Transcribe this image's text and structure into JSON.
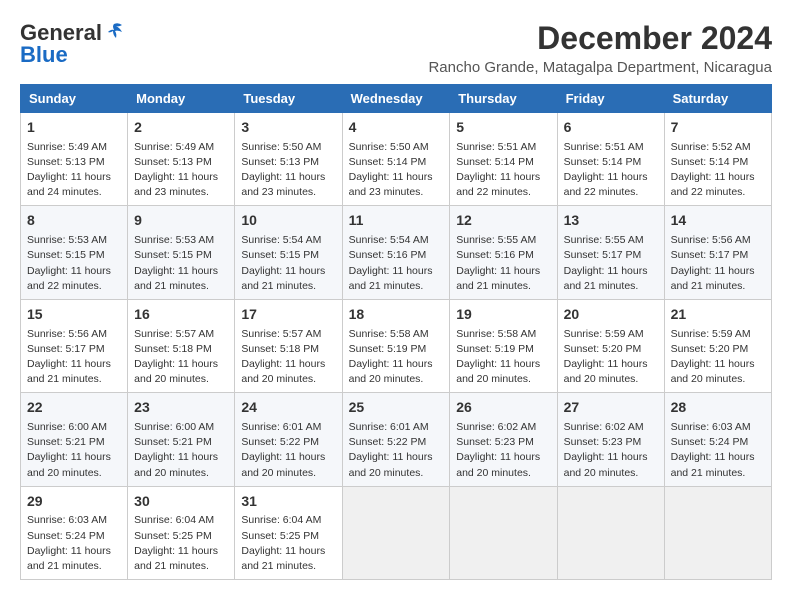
{
  "logo": {
    "general": "General",
    "blue": "Blue"
  },
  "title": "December 2024",
  "subtitle": "Rancho Grande, Matagalpa Department, Nicaragua",
  "columns": [
    "Sunday",
    "Monday",
    "Tuesday",
    "Wednesday",
    "Thursday",
    "Friday",
    "Saturday"
  ],
  "weeks": [
    [
      {
        "day": "1",
        "info": "Sunrise: 5:49 AM\nSunset: 5:13 PM\nDaylight: 11 hours\nand 24 minutes."
      },
      {
        "day": "2",
        "info": "Sunrise: 5:49 AM\nSunset: 5:13 PM\nDaylight: 11 hours\nand 23 minutes."
      },
      {
        "day": "3",
        "info": "Sunrise: 5:50 AM\nSunset: 5:13 PM\nDaylight: 11 hours\nand 23 minutes."
      },
      {
        "day": "4",
        "info": "Sunrise: 5:50 AM\nSunset: 5:14 PM\nDaylight: 11 hours\nand 23 minutes."
      },
      {
        "day": "5",
        "info": "Sunrise: 5:51 AM\nSunset: 5:14 PM\nDaylight: 11 hours\nand 22 minutes."
      },
      {
        "day": "6",
        "info": "Sunrise: 5:51 AM\nSunset: 5:14 PM\nDaylight: 11 hours\nand 22 minutes."
      },
      {
        "day": "7",
        "info": "Sunrise: 5:52 AM\nSunset: 5:14 PM\nDaylight: 11 hours\nand 22 minutes."
      }
    ],
    [
      {
        "day": "8",
        "info": "Sunrise: 5:53 AM\nSunset: 5:15 PM\nDaylight: 11 hours\nand 22 minutes."
      },
      {
        "day": "9",
        "info": "Sunrise: 5:53 AM\nSunset: 5:15 PM\nDaylight: 11 hours\nand 21 minutes."
      },
      {
        "day": "10",
        "info": "Sunrise: 5:54 AM\nSunset: 5:15 PM\nDaylight: 11 hours\nand 21 minutes."
      },
      {
        "day": "11",
        "info": "Sunrise: 5:54 AM\nSunset: 5:16 PM\nDaylight: 11 hours\nand 21 minutes."
      },
      {
        "day": "12",
        "info": "Sunrise: 5:55 AM\nSunset: 5:16 PM\nDaylight: 11 hours\nand 21 minutes."
      },
      {
        "day": "13",
        "info": "Sunrise: 5:55 AM\nSunset: 5:17 PM\nDaylight: 11 hours\nand 21 minutes."
      },
      {
        "day": "14",
        "info": "Sunrise: 5:56 AM\nSunset: 5:17 PM\nDaylight: 11 hours\nand 21 minutes."
      }
    ],
    [
      {
        "day": "15",
        "info": "Sunrise: 5:56 AM\nSunset: 5:17 PM\nDaylight: 11 hours\nand 21 minutes."
      },
      {
        "day": "16",
        "info": "Sunrise: 5:57 AM\nSunset: 5:18 PM\nDaylight: 11 hours\nand 20 minutes."
      },
      {
        "day": "17",
        "info": "Sunrise: 5:57 AM\nSunset: 5:18 PM\nDaylight: 11 hours\nand 20 minutes."
      },
      {
        "day": "18",
        "info": "Sunrise: 5:58 AM\nSunset: 5:19 PM\nDaylight: 11 hours\nand 20 minutes."
      },
      {
        "day": "19",
        "info": "Sunrise: 5:58 AM\nSunset: 5:19 PM\nDaylight: 11 hours\nand 20 minutes."
      },
      {
        "day": "20",
        "info": "Sunrise: 5:59 AM\nSunset: 5:20 PM\nDaylight: 11 hours\nand 20 minutes."
      },
      {
        "day": "21",
        "info": "Sunrise: 5:59 AM\nSunset: 5:20 PM\nDaylight: 11 hours\nand 20 minutes."
      }
    ],
    [
      {
        "day": "22",
        "info": "Sunrise: 6:00 AM\nSunset: 5:21 PM\nDaylight: 11 hours\nand 20 minutes."
      },
      {
        "day": "23",
        "info": "Sunrise: 6:00 AM\nSunset: 5:21 PM\nDaylight: 11 hours\nand 20 minutes."
      },
      {
        "day": "24",
        "info": "Sunrise: 6:01 AM\nSunset: 5:22 PM\nDaylight: 11 hours\nand 20 minutes."
      },
      {
        "day": "25",
        "info": "Sunrise: 6:01 AM\nSunset: 5:22 PM\nDaylight: 11 hours\nand 20 minutes."
      },
      {
        "day": "26",
        "info": "Sunrise: 6:02 AM\nSunset: 5:23 PM\nDaylight: 11 hours\nand 20 minutes."
      },
      {
        "day": "27",
        "info": "Sunrise: 6:02 AM\nSunset: 5:23 PM\nDaylight: 11 hours\nand 20 minutes."
      },
      {
        "day": "28",
        "info": "Sunrise: 6:03 AM\nSunset: 5:24 PM\nDaylight: 11 hours\nand 21 minutes."
      }
    ],
    [
      {
        "day": "29",
        "info": "Sunrise: 6:03 AM\nSunset: 5:24 PM\nDaylight: 11 hours\nand 21 minutes."
      },
      {
        "day": "30",
        "info": "Sunrise: 6:04 AM\nSunset: 5:25 PM\nDaylight: 11 hours\nand 21 minutes."
      },
      {
        "day": "31",
        "info": "Sunrise: 6:04 AM\nSunset: 5:25 PM\nDaylight: 11 hours\nand 21 minutes."
      },
      {
        "day": "",
        "info": ""
      },
      {
        "day": "",
        "info": ""
      },
      {
        "day": "",
        "info": ""
      },
      {
        "day": "",
        "info": ""
      }
    ]
  ]
}
